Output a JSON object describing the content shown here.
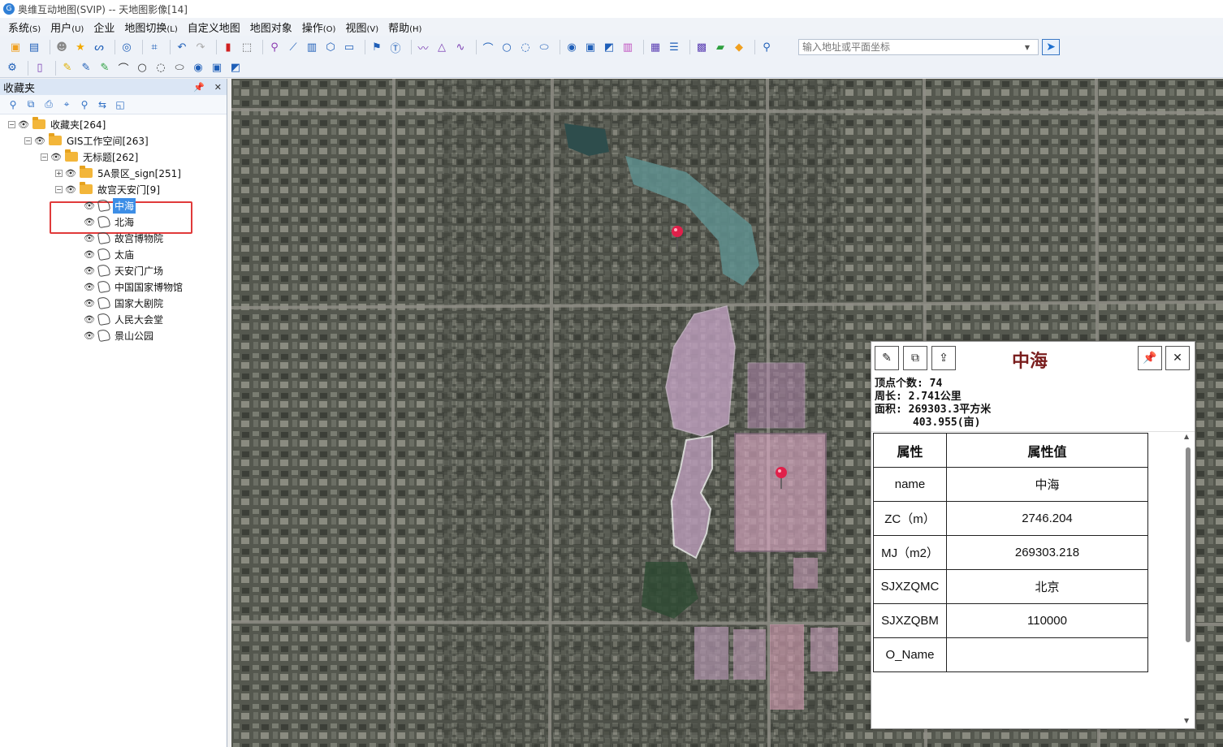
{
  "window": {
    "title": "奥维互动地图(SVIP) -- 天地图影像[14]"
  },
  "menu": [
    {
      "label": "系统",
      "key": "(S)"
    },
    {
      "label": "用户",
      "key": "(U)"
    },
    {
      "label": "企业",
      "key": ""
    },
    {
      "label": "地图切换",
      "key": "(L)"
    },
    {
      "label": "自定义地图",
      "key": ""
    },
    {
      "label": "地图对象",
      "key": ""
    },
    {
      "label": "操作",
      "key": "(O)"
    },
    {
      "label": "视图",
      "key": "(V)"
    },
    {
      "label": "帮助",
      "key": "(H)"
    }
  ],
  "search": {
    "placeholder": "输入地址或平面坐标"
  },
  "sidebar": {
    "title": "收藏夹",
    "pin_glyph": "📌",
    "close_glyph": "✕",
    "tree": [
      {
        "label": "收藏夹[264]",
        "type": "folder",
        "expander": "−"
      },
      {
        "label": "GIS工作空间[263]",
        "type": "folder",
        "expander": "−"
      },
      {
        "label": "无标题[262]",
        "type": "folder",
        "expander": "−"
      },
      {
        "label": "5A景区_sign[251]",
        "type": "folder",
        "expander": "+"
      },
      {
        "label": "故宫天安门[9]",
        "type": "folder",
        "expander": "−"
      },
      {
        "label": "中海",
        "type": "polygon",
        "selected": true
      },
      {
        "label": "北海",
        "type": "polygon"
      },
      {
        "label": "故宫博物院",
        "type": "polygon"
      },
      {
        "label": "太庙",
        "type": "polygon"
      },
      {
        "label": "天安门广场",
        "type": "polygon"
      },
      {
        "label": "中国国家博物馆",
        "type": "polygon"
      },
      {
        "label": "国家大剧院",
        "type": "polygon"
      },
      {
        "label": "人民大会堂",
        "type": "polygon"
      },
      {
        "label": "景山公园",
        "type": "polygon"
      }
    ]
  },
  "popup": {
    "title": "中海",
    "stats": {
      "vertices": "顶点个数: 74",
      "perimeter": "周长: 2.741公里",
      "area": "面积: 269303.3平方米",
      "area_mu": "      403.955(亩)"
    },
    "table": {
      "headers": [
        "属性",
        "属性值"
      ],
      "rows": [
        {
          "key": "name",
          "value": "中海"
        },
        {
          "key": "ZC（m）",
          "value": "2746.204"
        },
        {
          "key": "MJ（m2）",
          "value": "269303.218"
        },
        {
          "key": "SJXZQMC",
          "value": "北京"
        },
        {
          "key": "SJXZQBM",
          "value": "110000"
        },
        {
          "key": "O_Name",
          "value": ""
        }
      ]
    }
  },
  "colors": {
    "selection": "#3d8ee6",
    "highlight_border": "#e03a3a",
    "polygon_fill": "#c8a6c8",
    "popup_title": "#7a1e1e"
  }
}
